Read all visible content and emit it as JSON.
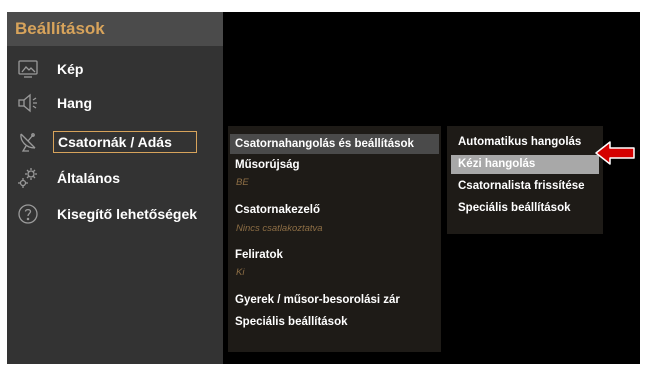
{
  "sidebar": {
    "title": "Beállítások",
    "items": [
      {
        "label": "Kép",
        "icon": "picture-icon"
      },
      {
        "label": "Hang",
        "icon": "speaker-icon"
      },
      {
        "label": "Csatornák / Adás",
        "icon": "satellite-dish-icon",
        "selected": true
      },
      {
        "label": "Általános",
        "icon": "gears-icon"
      },
      {
        "label": "Kisegítő lehetőségek",
        "icon": "help-circle-icon"
      }
    ]
  },
  "channel_menu": {
    "items": [
      {
        "label": "Csatornahangolás és beállítások"
      },
      {
        "label": "Műsorújság",
        "sub": "BE"
      },
      {
        "label": "Csatornakezelő",
        "sub": "Nincs csatlakoztatva"
      },
      {
        "label": "Feliratok",
        "sub": "Ki"
      },
      {
        "label": "Gyerek / műsor-besorolási zár"
      },
      {
        "label": "Speciális beállítások"
      }
    ]
  },
  "tuning_menu": {
    "items": [
      {
        "label": "Automatikus hangolás"
      },
      {
        "label": "Kézi hangolás",
        "selected": true
      },
      {
        "label": "Csatornalista frissítése"
      },
      {
        "label": "Speciális beállítások"
      }
    ]
  },
  "colors": {
    "accent": "#d7a35b",
    "arrow": "#d40000",
    "sidebar_bg": "#333333",
    "screen_bg": "#000000"
  }
}
